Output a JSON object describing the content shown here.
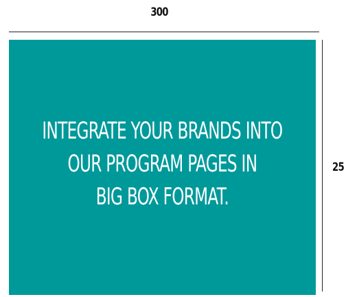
{
  "dimensions": {
    "width_label": "300",
    "height_label": "25"
  },
  "ad_box": {
    "background_color": "#00999a",
    "text_lines": [
      "INTEGRATE YOUR BRANDS INTO",
      "OUR PROGRAM PAGES IN",
      "BIG BOX FORMAT."
    ]
  }
}
